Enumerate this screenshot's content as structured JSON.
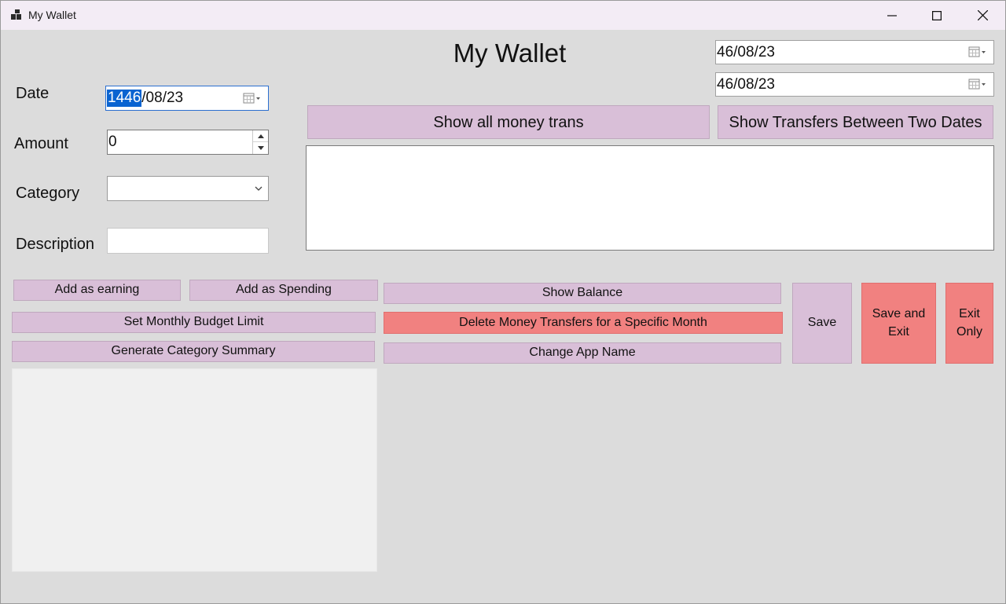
{
  "window": {
    "title": "My Wallet",
    "controls": [
      "minimize-icon",
      "maximize-icon",
      "close-icon"
    ]
  },
  "header": {
    "title": "My Wallet"
  },
  "form": {
    "date_label": "Date",
    "date_selected": "1446",
    "date_rest": "/08/23",
    "amount_label": "Amount",
    "amount_value": "0",
    "category_label": "Category",
    "category_value": "",
    "description_label": "Description",
    "description_value": ""
  },
  "filter": {
    "from_date": "46/08/23",
    "to_date": "46/08/23",
    "show_all_label": "Show all money trans",
    "show_between_label": "Show Transfers Between Two Dates"
  },
  "actions": {
    "add_earning": "Add as earning",
    "add_spending": "Add as Spending",
    "show_balance": "Show Balance",
    "set_budget": "Set Monthly Budget Limit",
    "delete_month": "Delete Money Transfers for a Specific Month",
    "category_summary": "Generate Category Summary",
    "change_name": "Change App Name",
    "save": "Save",
    "save_exit_line1": "Save and",
    "save_exit_line2": "Exit",
    "exit_line1": "Exit",
    "exit_line2": "Only"
  },
  "colors": {
    "button": "#d9bfd8",
    "danger_button": "#f18180",
    "window_bg": "#dcdcdc",
    "selection": "#0a64d1"
  }
}
